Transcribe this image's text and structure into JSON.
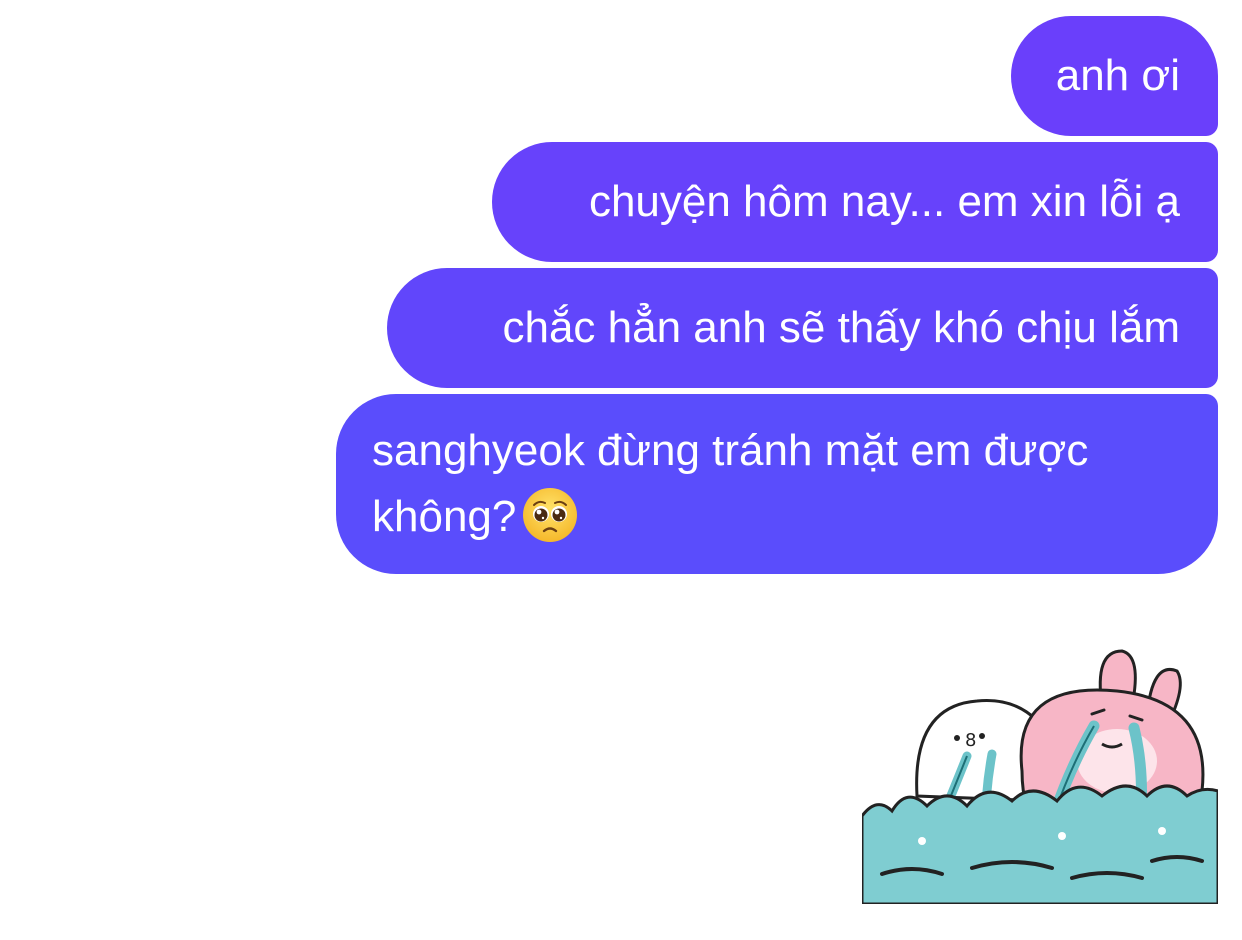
{
  "messages": [
    {
      "text": "anh ơi"
    },
    {
      "text": "chuyện hôm nay... em xin lỗi ạ"
    },
    {
      "text": "chắc hẳn anh sẽ thấy khó chịu lắm"
    },
    {
      "text": "sanghyeok đừng tránh mặt em được không?",
      "emoji": "pleading-face-emoji"
    }
  ],
  "sticker": {
    "icon": "crying-bunnies-sticker"
  },
  "colors": {
    "bubble_top": "#6a3ffb",
    "bubble_bottom": "#5a4dfc",
    "water": "#7fcdd1",
    "bunny_pink": "#f7b6c6"
  }
}
